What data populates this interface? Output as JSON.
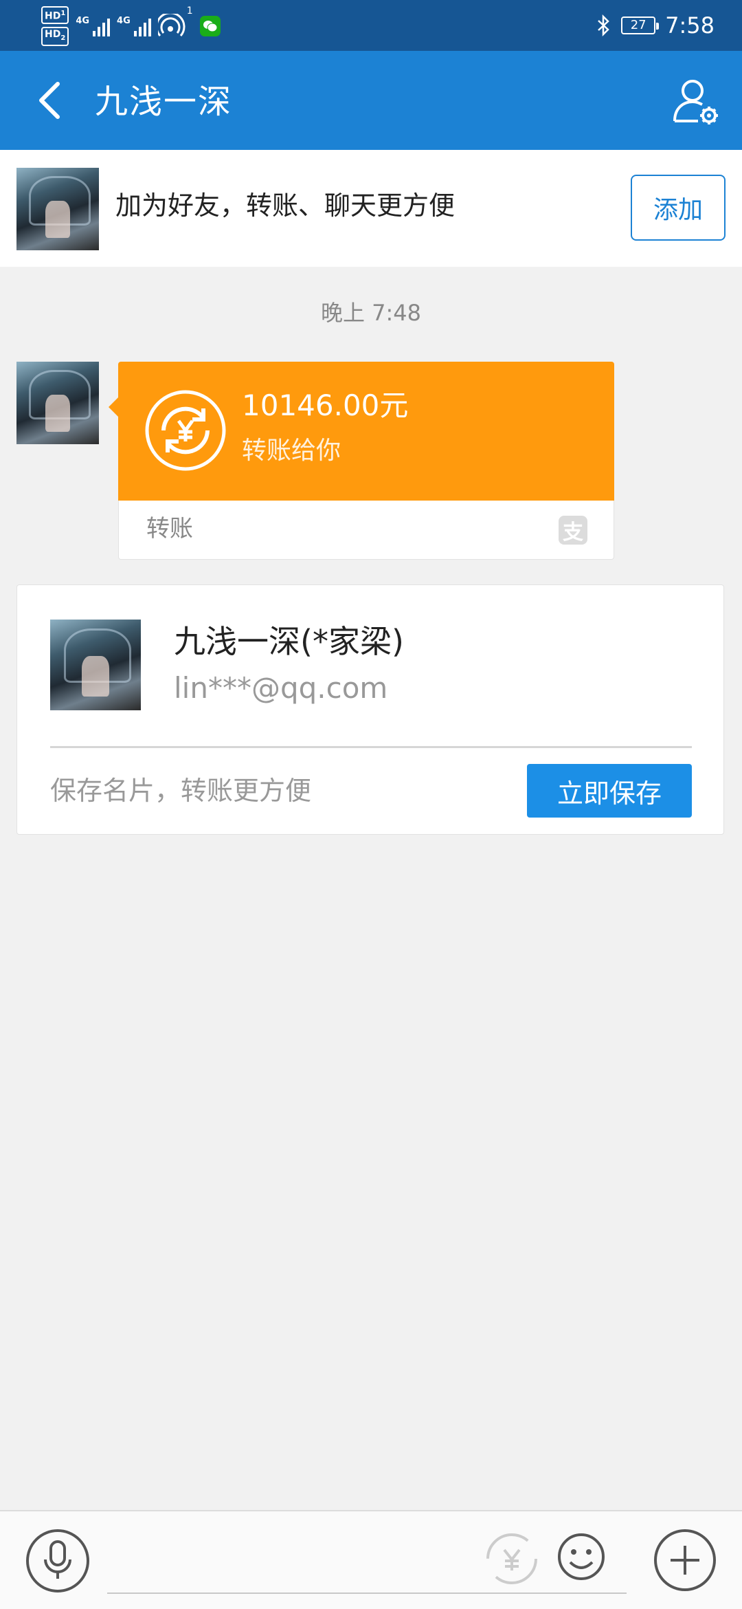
{
  "status_bar": {
    "hd_1": "HD",
    "hd_1_sub": "1",
    "hd_2": "HD",
    "hd_2_sub": "2",
    "network_1": "4G",
    "network_2": "4G",
    "hotspot_count": "1",
    "battery": "27",
    "time": "7:58",
    "icons": [
      "signal-icon",
      "wifi-hotspot-icon",
      "wechat-icon",
      "bluetooth-icon",
      "battery-icon"
    ]
  },
  "header": {
    "title": "九浅一深",
    "back_icon": "chevron-left-icon",
    "settings_icon": "user-settings-icon"
  },
  "add_friend_banner": {
    "text": "加为好友，转账、聊天更方便",
    "button_label": "添加"
  },
  "chat": {
    "timestamp": "晚上 7:48",
    "transfer": {
      "amount": "10146.00元",
      "subtitle": "转账给你",
      "footer_label": "转账",
      "colors": {
        "card": "#ff9a0d"
      },
      "icons": [
        "yuan-transfer-icon",
        "alipay-icon"
      ]
    },
    "contact_card": {
      "name": "九浅一深(*家梁)",
      "email": "lin***@qq.com",
      "hint": "保存名片，转账更方便",
      "button_label": "立即保存"
    }
  },
  "input_bar": {
    "icons": [
      "microphone-icon",
      "yuan-icon",
      "emoji-icon",
      "plus-icon"
    ]
  },
  "colors": {
    "status_bar": "#165694",
    "header": "#1c82d4",
    "accent": "#1c8fe6",
    "background": "#f1f1f1"
  }
}
